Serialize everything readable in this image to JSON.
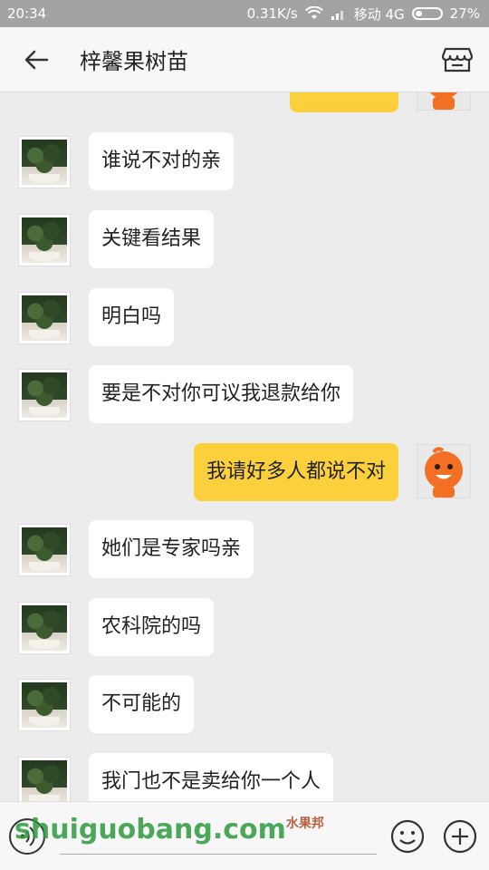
{
  "status_bar": {
    "time": "20:34",
    "speed": "0.31K/s",
    "carrier": "移动 4G",
    "battery": "27%",
    "battery_level": 0.27
  },
  "header": {
    "title": "梓馨果树苗",
    "back_icon": "arrow-left-icon",
    "shop_icon": "store-icon"
  },
  "messages": [
    {
      "side": "right",
      "text": "",
      "partial": true
    },
    {
      "side": "left",
      "text": "谁说不对的亲"
    },
    {
      "side": "left",
      "text": "关键看结果"
    },
    {
      "side": "left",
      "text": "明白吗"
    },
    {
      "side": "left",
      "text": "要是不对你可议我退款给你"
    },
    {
      "side": "right",
      "text": "我请好多人都说不对"
    },
    {
      "side": "left",
      "text": "她们是专家吗亲"
    },
    {
      "side": "left",
      "text": "农科院的吗"
    },
    {
      "side": "left",
      "text": "不可能的"
    },
    {
      "side": "left",
      "text": "我门也不是卖给你一个人"
    }
  ],
  "input_bar": {
    "placeholder": "",
    "voice_icon": "voice-icon",
    "emoji_icon": "emoji-icon",
    "plus_icon": "plus-icon"
  },
  "watermark": {
    "text": "shuiguobang.com",
    "small": "水果邦"
  },
  "colors": {
    "self_bubble": "#fbd03c",
    "other_bubble": "#ffffff",
    "background": "#ececec",
    "watermark": "#2e9a3e"
  }
}
